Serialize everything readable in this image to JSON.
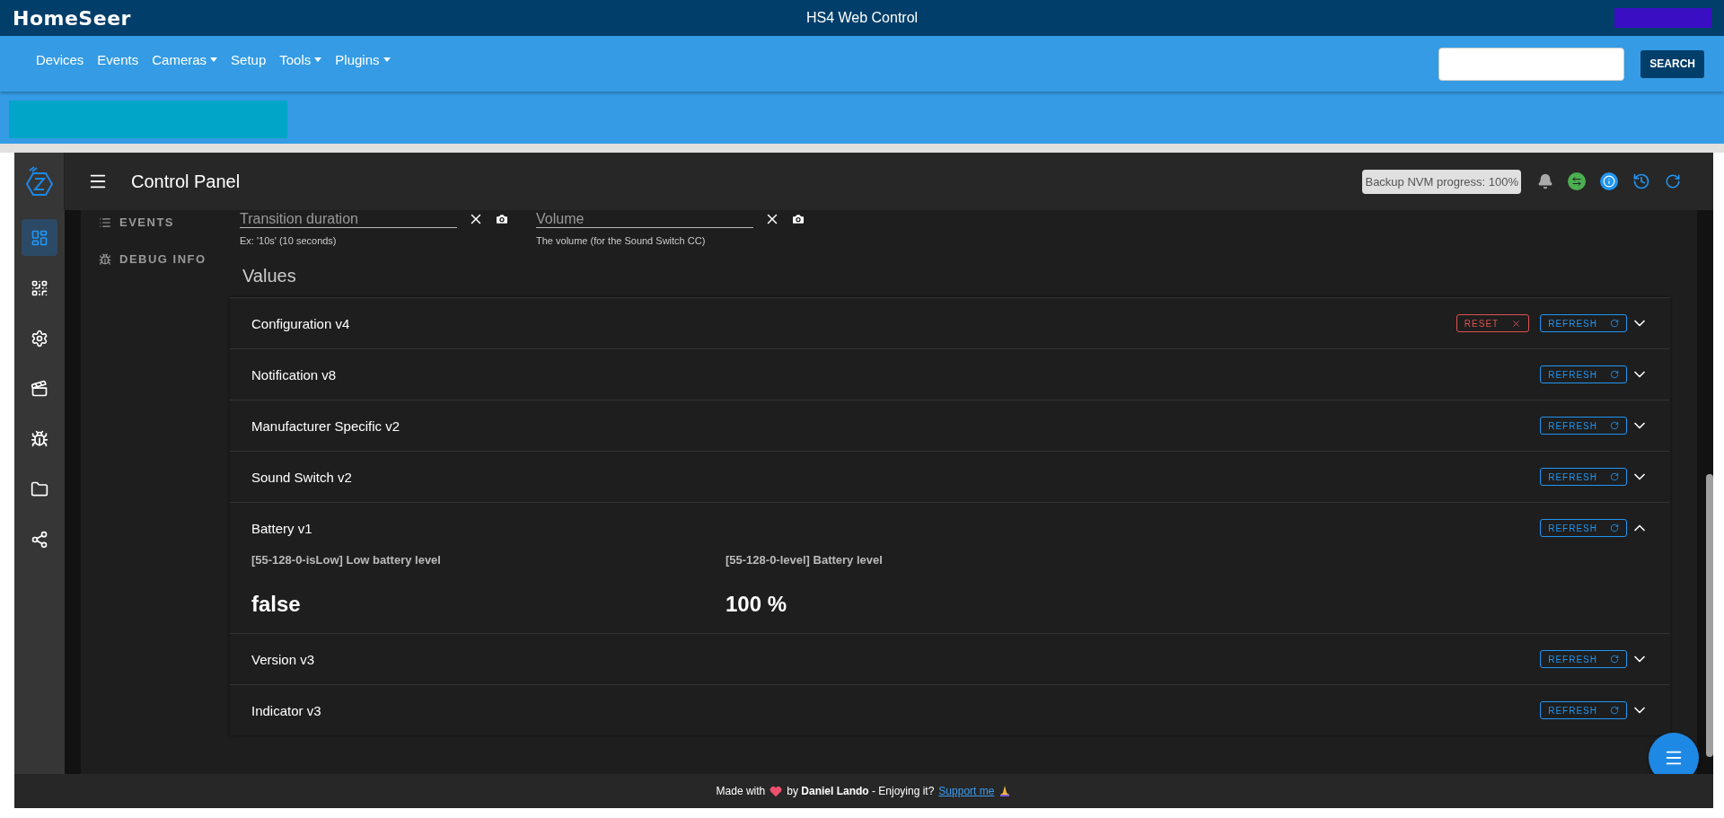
{
  "top_bar": {
    "logo": "HomeSeer",
    "title": "HS4 Web Control"
  },
  "nav": {
    "items": [
      {
        "label": "Devices",
        "dropdown": false
      },
      {
        "label": "Events",
        "dropdown": false
      },
      {
        "label": "Cameras",
        "dropdown": true
      },
      {
        "label": "Setup",
        "dropdown": false
      },
      {
        "label": "Tools",
        "dropdown": true
      },
      {
        "label": "Plugins",
        "dropdown": true
      }
    ],
    "search_button": "SEARCH"
  },
  "app": {
    "header": {
      "title": "Control Panel",
      "badge": "Backup NVM progress: 100%"
    },
    "rail": [
      {
        "kind": "dashboard",
        "selected": true
      },
      {
        "kind": "qr",
        "selected": false
      },
      {
        "kind": "settings",
        "selected": false
      },
      {
        "kind": "scenes",
        "selected": false
      },
      {
        "kind": "debug",
        "selected": false
      },
      {
        "kind": "files",
        "selected": false
      },
      {
        "kind": "share",
        "selected": false
      }
    ],
    "side_menu": [
      {
        "kind": "list",
        "label": "EVENTS"
      },
      {
        "kind": "debug",
        "label": "DEBUG INFO"
      }
    ],
    "fields": [
      {
        "placeholder": "Transition duration",
        "hint": "Ex: '10s' (10 seconds)"
      },
      {
        "placeholder": "Volume",
        "hint": "The volume (for the Sound Switch CC)"
      }
    ],
    "values_heading": "Values",
    "panels": [
      {
        "title": "Configuration v4",
        "reset": "RESET",
        "refresh": "REFRESH",
        "expanded": false
      },
      {
        "title": "Notification v8",
        "refresh": "REFRESH",
        "expanded": false
      },
      {
        "title": "Manufacturer Specific v2",
        "refresh": "REFRESH",
        "expanded": false
      },
      {
        "title": "Sound Switch v2",
        "refresh": "REFRESH",
        "expanded": false
      },
      {
        "title": "Battery v1",
        "refresh": "REFRESH",
        "expanded": true,
        "values": [
          {
            "label": "[55-128-0-isLow] Low battery level",
            "value": "false"
          },
          {
            "label": "[55-128-0-level] Battery level",
            "value": "100 %"
          }
        ]
      },
      {
        "title": "Version v3",
        "refresh": "REFRESH",
        "expanded": false
      },
      {
        "title": "Indicator v3",
        "refresh": "REFRESH",
        "expanded": false
      }
    ],
    "footer": {
      "lead": "Made with",
      "credit": "by **Daniel Lando**  - Enjoying it?",
      "link": "Support me"
    }
  }
}
